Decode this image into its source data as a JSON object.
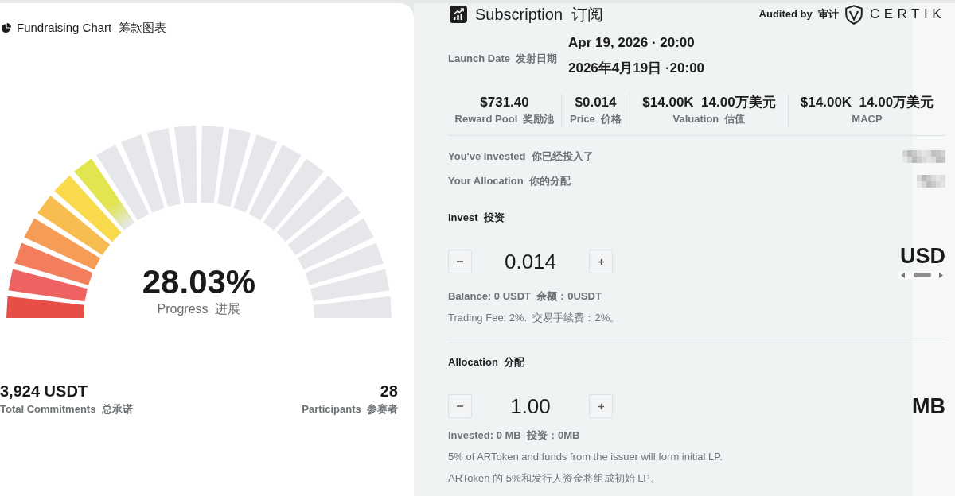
{
  "fundraising": {
    "title": "Fundraising Chart  筹款图表",
    "progress": {
      "level": 0.2803,
      "percent": "28.03%",
      "label": "Progress  进展"
    },
    "stats": [
      {
        "value": "3,924 USDT",
        "label": "Total Commitments  总承诺"
      },
      {
        "value": "28",
        "label": "Participants  参赛者"
      }
    ]
  },
  "subscription": {
    "title": "Subscription  订阅",
    "audit": {
      "label": "Audited by  审计",
      "logo_text": "CERTIK"
    },
    "launch_date": {
      "label": "Launch Date  发射日期",
      "values": [
        "Apr 19, 2026 · 20:00",
        "2026年4月19日 ·20:00"
      ]
    },
    "metrics": [
      {
        "value": "$731.40",
        "label": "Reward Pool  奖励池"
      },
      {
        "value": "$0.014",
        "label": "Price  价格"
      },
      {
        "value": "$14.00K  14.00万美元",
        "label": "Valuation  估值"
      },
      {
        "value": "$14.00K  14.00万美元",
        "label": "MACP"
      }
    ],
    "holdings": [
      {
        "label": "You've Invested  你已经投入了"
      },
      {
        "label": "Your Allocation  你的分配"
      }
    ],
    "sections": [
      {
        "heading": "Invest  投资",
        "value": "0.014",
        "unit": "USD",
        "unit_scrollbar": true,
        "notes": [
          {
            "kind": "strong",
            "text": "Balance: 0 USDT  余额：0USDT"
          },
          {
            "kind": "plain",
            "text": "Trading Fee: 2%.  交易手续费：2%。"
          }
        ]
      },
      {
        "heading": "Allocation  分配",
        "value": "1.00",
        "unit": "MB",
        "notes": [
          {
            "kind": "strong",
            "text": "Invested: 0 MB  投资：0MB"
          },
          {
            "kind": "plain",
            "text": "5% of ARToken and funds from the issuer will form initial LP."
          },
          {
            "kind": "plain",
            "text": "ARToken 的 5%和发行人资金将组成初始 LP。"
          }
        ]
      }
    ]
  }
}
